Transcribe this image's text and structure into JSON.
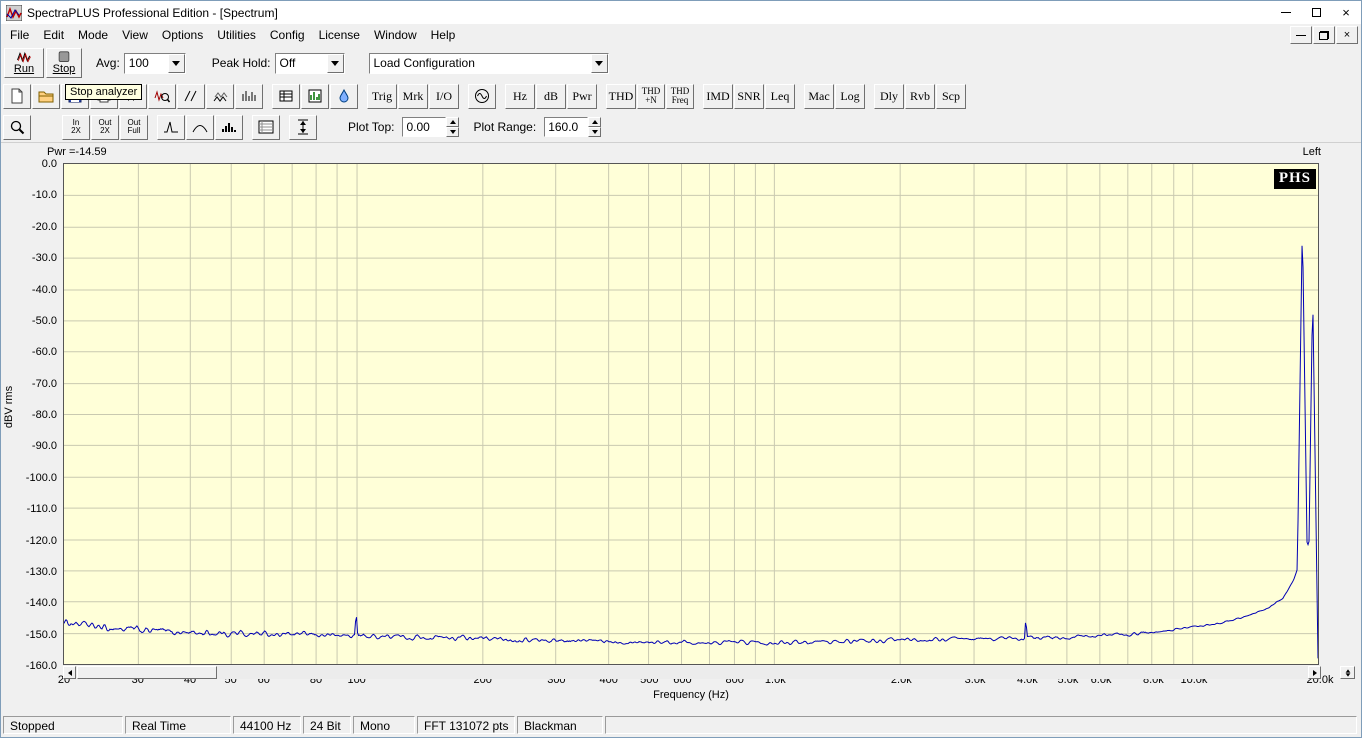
{
  "window": {
    "title": "SpectraPLUS Professional Edition - [Spectrum]"
  },
  "menu": {
    "items": [
      "File",
      "Edit",
      "Mode",
      "View",
      "Options",
      "Utilities",
      "Config",
      "License",
      "Window",
      "Help"
    ]
  },
  "toolbar_main": {
    "run_label": "Run",
    "stop_label": "Stop",
    "avg_label": "Avg:",
    "avg_value": "100",
    "peak_hold_label": "Peak Hold:",
    "peak_hold_value": "Off",
    "load_config_value": "Load Configuration"
  },
  "tooltip": "Stop analyzer",
  "toolbar2": {
    "text_buttons": [
      "Trig",
      "Mrk",
      "I/O",
      "Hz",
      "dB",
      "Pwr",
      "THD",
      "THD\n+N",
      "THD\nFreq",
      "IMD",
      "SNR",
      "Leq",
      "Mac",
      "Log",
      "Dly",
      "Rvb",
      "Scp"
    ]
  },
  "toolbar3": {
    "in2x": "In\n2X",
    "out2x": "Out\n2X",
    "outfull": "Out\nFull",
    "plot_top_label": "Plot Top:",
    "plot_top_value": "0.00",
    "plot_range_label": "Plot Range:",
    "plot_range_value": "160.0"
  },
  "chart": {
    "pwr_label": "Pwr =-14.59",
    "channel_label": "Left",
    "logo": "PHS"
  },
  "chart_data": {
    "type": "line",
    "title": "Spectrum",
    "xlabel": "Frequency (Hz)",
    "ylabel": "dBV rms",
    "x_scale": "log",
    "xlim": [
      20,
      20000
    ],
    "ylim": [
      -160,
      0
    ],
    "grid": true,
    "y_tick_labels": [
      "0.0",
      "-10.0",
      "-20.0",
      "-30.0",
      "-40.0",
      "-50.0",
      "-60.0",
      "-70.0",
      "-80.0",
      "-90.0",
      "-100.0",
      "-110.0",
      "-120.0",
      "-130.0",
      "-140.0",
      "-150.0",
      "-160.0"
    ],
    "x_ticks": [
      {
        "f": 20,
        "label": "20"
      },
      {
        "f": 30,
        "label": "30"
      },
      {
        "f": 40,
        "label": "40"
      },
      {
        "f": 50,
        "label": "50"
      },
      {
        "f": 60,
        "label": "60"
      },
      {
        "f": 80,
        "label": "80"
      },
      {
        "f": 100,
        "label": "100"
      },
      {
        "f": 200,
        "label": "200"
      },
      {
        "f": 300,
        "label": "300"
      },
      {
        "f": 400,
        "label": "400"
      },
      {
        "f": 500,
        "label": "500"
      },
      {
        "f": 600,
        "label": "600"
      },
      {
        "f": 800,
        "label": "800"
      },
      {
        "f": 1000,
        "label": "1.0k"
      },
      {
        "f": 2000,
        "label": "2.0k"
      },
      {
        "f": 3000,
        "label": "3.0k"
      },
      {
        "f": 4000,
        "label": "4.0k"
      },
      {
        "f": 5000,
        "label": "5.0k"
      },
      {
        "f": 6000,
        "label": "6.0k"
      },
      {
        "f": 8000,
        "label": "8.0k"
      },
      {
        "f": 10000,
        "label": "10.0k"
      },
      {
        "f": 20000,
        "label": "20.0k"
      }
    ],
    "series": [
      {
        "name": "Left",
        "color": "#0000b4",
        "measured_power_db": -14.59,
        "noise_floor_anchors": [
          [
            20,
            -146.5
          ],
          [
            25,
            -148.5
          ],
          [
            40,
            -150
          ],
          [
            70,
            -150.5
          ],
          [
            100,
            -151
          ],
          [
            150,
            -151.5
          ],
          [
            300,
            -152.5
          ],
          [
            600,
            -153
          ],
          [
            1000,
            -153
          ],
          [
            2000,
            -152.5
          ],
          [
            3000,
            -152
          ],
          [
            5000,
            -151.5
          ],
          [
            7000,
            -150.5
          ],
          [
            9000,
            -149
          ],
          [
            11000,
            -147.5
          ],
          [
            13000,
            -145.5
          ],
          [
            15000,
            -142.5
          ],
          [
            16500,
            -139
          ],
          [
            17500,
            -133
          ],
          [
            18000,
            -128
          ],
          [
            18400,
            -124
          ],
          [
            19000,
            -121.5
          ],
          [
            19300,
            -126
          ],
          [
            19500,
            -136
          ],
          [
            19700,
            -150
          ],
          [
            19850,
            -160
          ],
          [
            20000,
            -160
          ]
        ],
        "spurs": [
          {
            "freq": 100,
            "db": -143.2
          },
          {
            "freq": 4000,
            "db": -145.0
          },
          {
            "freq": 9700,
            "db": -146.5
          }
        ],
        "tones": [
          {
            "freq": 18350,
            "db": -18.6
          },
          {
            "freq": 19420,
            "db": -40.5
          }
        ]
      }
    ]
  },
  "status_bar": {
    "cells": [
      "Stopped",
      "Real Time",
      "44100 Hz",
      "24 Bit",
      "Mono",
      "FFT 131072 pts",
      "Blackman"
    ]
  },
  "colors": {
    "plot_bg": "#ffffd8",
    "grid": "#c9c9b0",
    "trace": "#0000b4",
    "frame": "#555555"
  }
}
